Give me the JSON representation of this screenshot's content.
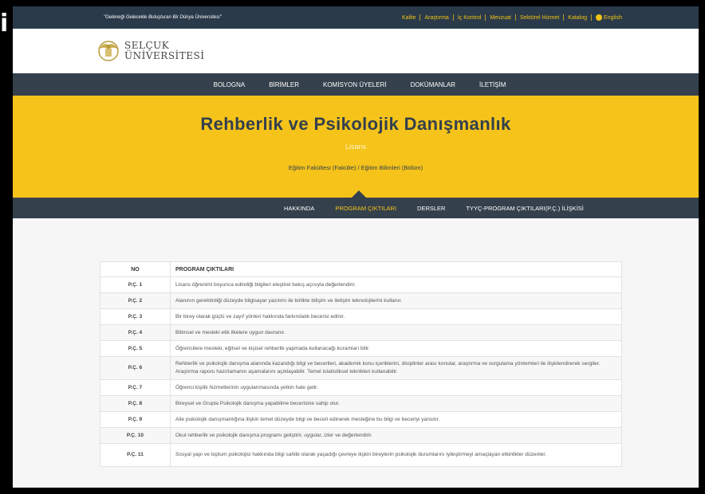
{
  "topbar": {
    "motto": "\"Geleneği Gelecekle Buluşturan Bir Dünya Üniversitesi\"",
    "links": [
      "Kalite",
      "Araştırma",
      "İç Kontrol",
      "Mevzuat",
      "Sektörel Hizmet",
      "Katalog"
    ],
    "language": "English"
  },
  "logo": {
    "line1": "SELÇUK",
    "line2": "ÜNİVERSİTESİ"
  },
  "main_nav": [
    "BOLOGNA",
    "BİRİMLER",
    "KOMİSYON ÜYELERİ",
    "DOKÜMANLAR",
    "İLETİŞİM"
  ],
  "hero": {
    "title": "Rehberlik ve Psikolojik Danışmanlık",
    "level": "Lisans",
    "breadcrumb": "Eğitim Fakültesi (Fakülte)  /  Eğitim Bilimleri (Bölüm)"
  },
  "sub_nav": {
    "items": [
      "HAKKINDA",
      "PROGRAM ÇIKTILARI",
      "DERSLER",
      "TYYÇ-PROGRAM ÇIKTILARI(P.Ç.) İLİŞKİSİ"
    ],
    "active_index": 1
  },
  "table": {
    "headers": [
      "NO",
      "PROGRAM ÇIKTILARI"
    ],
    "rows": [
      {
        "no": "P.Ç. 1",
        "text": "Lisans öğrenimi boyunca edindiği bilgileri eleştirel bakış açısıyla değerlendirir."
      },
      {
        "no": "P.Ç. 2",
        "text": "Alanının gerektirdiği düzeyde bilgisayar yazılımı ile birlikte bilişim ve iletişim teknolojilerini kullanır."
      },
      {
        "no": "P.Ç. 3",
        "text": "Bir birey olarak güçlü ve zayıf yönleri hakkında farkındalık becerisi edinir."
      },
      {
        "no": "P.Ç. 4",
        "text": "Bilimsel ve mesleki etik ilkelere uygun davranır."
      },
      {
        "no": "P.Ç. 5",
        "text": "Öğrencilere mesleki, eğitsel ve kişisel rehberlik yapmada kullanacağı kuramları bilir."
      },
      {
        "no": "P.Ç. 6",
        "text": "Rehberlik ve psikolojik danışma alanında kazandığı bilgi ve becerileri, akademik konu içeriklerini, disiplinler arası konular, araştırma ve sorgulama yöntemleri ile ilişkilendirerek sergiler. Araştırma raporu hazırlamanın aşamalarını açıklayabilir. Temel istatistiksel teknikleri kullanabilir."
      },
      {
        "no": "P.Ç. 7",
        "text": "Öğrenci kişilik hizmetlerinin uygulanmasında yetkin hale gelir."
      },
      {
        "no": "P.Ç. 8",
        "text": "Bireysel ve Grupla Psikolojik danışma yapabilme becerisine sahip olur."
      },
      {
        "no": "P.Ç. 9",
        "text": "Aile psikolojik danışmanlığına ilişkin temel düzeyde bilgi ve beceri edinerek mesleğine bu bilgi ve beceriyi yansıtır."
      },
      {
        "no": "P.Ç. 10",
        "text": "Okul rehberlik ve psikolojik danışma programı geliştirir, uygular, izler ve değerlendirir."
      },
      {
        "no": "P.Ç. 11",
        "text": "Sosyal yapı ve toplum psikolojisi hakkında bilgi sahibi olarak yaşadığı çevreye ilişkin bireylerin psikolojik durumlarını iyileştirmeyi amaçlayan etkinlikler düzenler."
      }
    ]
  },
  "colors": {
    "accent": "#f5c31a",
    "nav_bg": "#34404c",
    "topbar_bg": "#2a3a4a"
  }
}
